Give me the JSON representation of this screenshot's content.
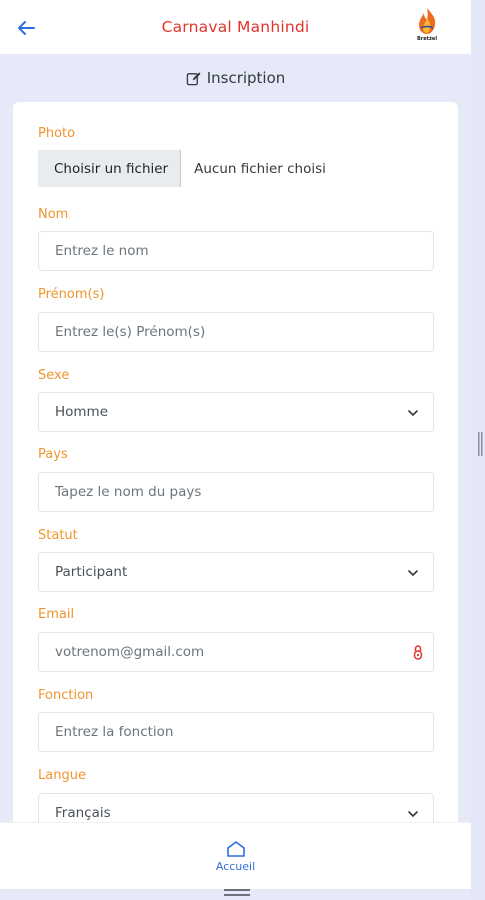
{
  "header": {
    "title": "Carnaval Manhindi",
    "logo_text": "Bretzel"
  },
  "section": {
    "title": "Inscription"
  },
  "form": {
    "photo": {
      "label": "Photo",
      "button": "Choisir un fichier",
      "status": "Aucun fichier choisi"
    },
    "nom": {
      "label": "Nom",
      "placeholder": "Entrez le nom"
    },
    "prenoms": {
      "label": "Prénom(s)",
      "placeholder": "Entrez le(s) Prénom(s)"
    },
    "sexe": {
      "label": "Sexe",
      "value": "Homme"
    },
    "pays": {
      "label": "Pays",
      "placeholder": "Tapez le nom du pays"
    },
    "statut": {
      "label": "Statut",
      "value": "Participant"
    },
    "email": {
      "label": "Email",
      "placeholder": "votrenom@gmail.com"
    },
    "fonction": {
      "label": "Fonction",
      "placeholder": "Entrez la fonction"
    },
    "langue": {
      "label": "Langue",
      "value": "Français"
    }
  },
  "bottom_nav": {
    "home_label": "Accueil"
  },
  "colors": {
    "title": "#e2342d",
    "label": "#f0952e",
    "accent": "#2f6ee0",
    "background": "#e5e9f8"
  }
}
